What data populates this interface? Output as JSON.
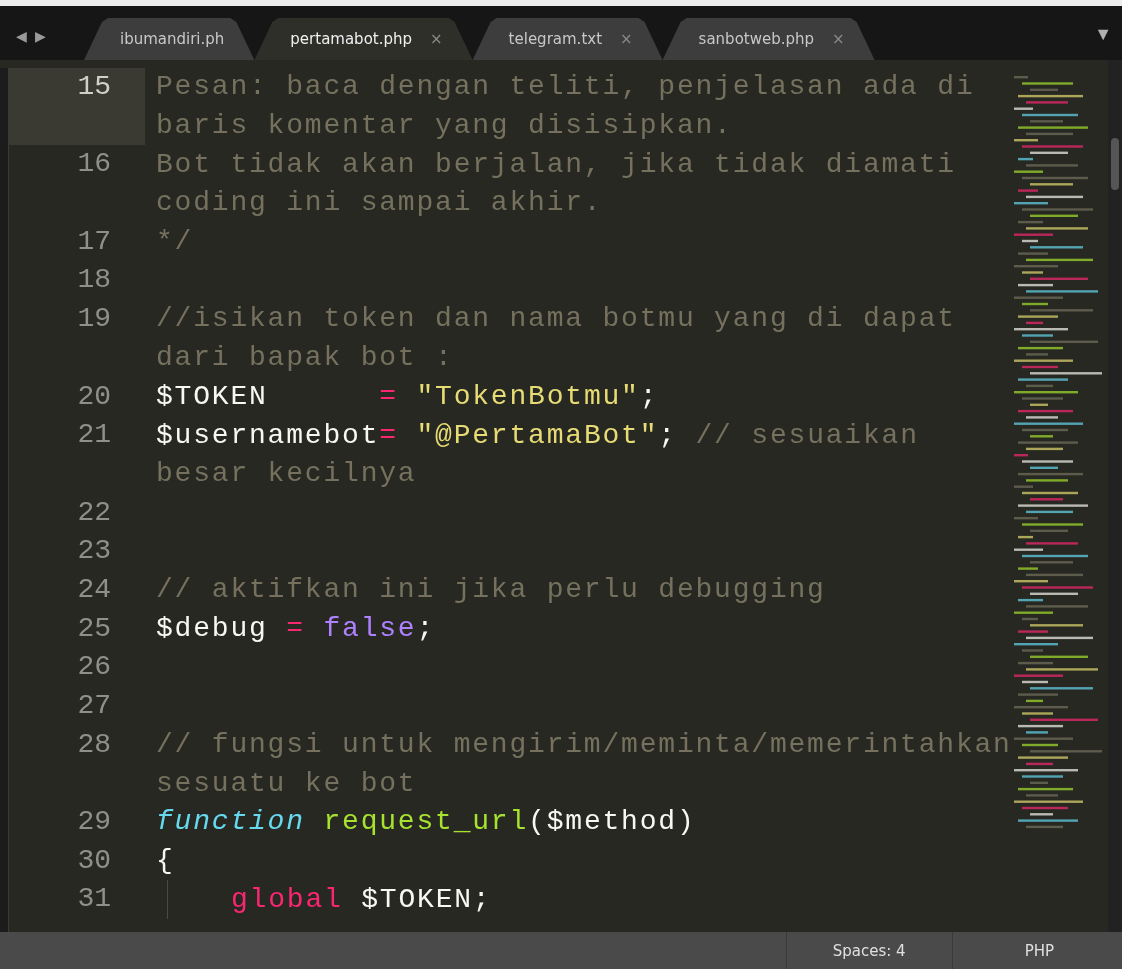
{
  "tab_bar": {
    "back": "◀",
    "forward": "▶",
    "menu": "▼",
    "tabs": [
      {
        "label": "ibumandiri.ph",
        "selected": false
      },
      {
        "label": "pertamabot.php",
        "close": "×",
        "selected": true
      },
      {
        "label": "telegram.txt",
        "close": "×",
        "selected": false
      },
      {
        "label": "sanbotweb.php",
        "close": "×",
        "selected": false
      }
    ]
  },
  "editor": {
    "lines": [
      {
        "number": "15",
        "current": true,
        "rows": [
          [
            {
              "kind": "comment",
              "text": "Pesan: baca dengan teliti, penjelasan ada di"
            }
          ],
          [
            {
              "kind": "comment",
              "text": "baris komentar yang disisipkan."
            }
          ]
        ]
      },
      {
        "number": "16",
        "current": false,
        "rows": [
          [
            {
              "kind": "comment",
              "text": "Bot tidak akan berjalan, jika tidak diamati"
            }
          ],
          [
            {
              "kind": "comment",
              "text": "coding ini sampai akhir."
            }
          ]
        ]
      },
      {
        "number": "17",
        "current": false,
        "rows": [
          [
            {
              "kind": "comment",
              "text": "*/"
            }
          ]
        ]
      },
      {
        "number": "18",
        "current": false,
        "rows": [
          []
        ]
      },
      {
        "number": "19",
        "current": false,
        "rows": [
          [
            {
              "kind": "comment",
              "text": "//isikan token dan nama botmu yang di dapat"
            }
          ],
          [
            {
              "kind": "comment",
              "text": "dari bapak bot :"
            }
          ]
        ]
      },
      {
        "number": "20",
        "current": false,
        "rows": [
          [
            {
              "kind": "plain",
              "text": "$TOKEN      "
            },
            {
              "kind": "operator",
              "text": "="
            },
            {
              "kind": "plain",
              "text": " "
            },
            {
              "kind": "string",
              "text": "\"TokenBotmu\""
            },
            {
              "kind": "plain",
              "text": ";"
            }
          ]
        ]
      },
      {
        "number": "21",
        "current": false,
        "rows": [
          [
            {
              "kind": "plain",
              "text": "$usernamebot"
            },
            {
              "kind": "operator",
              "text": "="
            },
            {
              "kind": "plain",
              "text": " "
            },
            {
              "kind": "string",
              "text": "\"@PertamaBot\""
            },
            {
              "kind": "plain",
              "text": "; "
            },
            {
              "kind": "comment",
              "text": "// sesuaikan"
            }
          ],
          [
            {
              "kind": "comment",
              "text": "besar kecilnya"
            }
          ]
        ]
      },
      {
        "number": "22",
        "current": false,
        "rows": [
          []
        ]
      },
      {
        "number": "23",
        "current": false,
        "rows": [
          []
        ]
      },
      {
        "number": "24",
        "current": false,
        "rows": [
          [
            {
              "kind": "comment",
              "text": "// aktifkan ini jika perlu debugging"
            }
          ]
        ]
      },
      {
        "number": "25",
        "current": false,
        "rows": [
          [
            {
              "kind": "plain",
              "text": "$debug "
            },
            {
              "kind": "operator",
              "text": "="
            },
            {
              "kind": "plain",
              "text": " "
            },
            {
              "kind": "constant",
              "text": "false"
            },
            {
              "kind": "plain",
              "text": ";"
            }
          ]
        ]
      },
      {
        "number": "26",
        "current": false,
        "rows": [
          []
        ]
      },
      {
        "number": "27",
        "current": false,
        "rows": [
          []
        ]
      },
      {
        "number": "28",
        "current": false,
        "rows": [
          [
            {
              "kind": "comment",
              "text": "// fungsi untuk mengirim/meminta/memerintahkan"
            }
          ],
          [
            {
              "kind": "comment",
              "text": "sesuatu ke bot"
            }
          ]
        ]
      },
      {
        "number": "29",
        "current": false,
        "rows": [
          [
            {
              "kind": "storage",
              "text": "function"
            },
            {
              "kind": "plain",
              "text": " "
            },
            {
              "kind": "entity",
              "text": "request_url"
            },
            {
              "kind": "plain",
              "text": "($method)"
            }
          ]
        ]
      },
      {
        "number": "30",
        "current": false,
        "rows": [
          [
            {
              "kind": "plain",
              "text": "{"
            }
          ]
        ]
      },
      {
        "number": "31",
        "current": false,
        "indented": true,
        "rows": [
          [
            {
              "kind": "operator",
              "text": "global"
            },
            {
              "kind": "plain",
              "text": " $TOKEN;"
            }
          ]
        ]
      }
    ]
  },
  "status_bar": {
    "indentation": "Spaces: 4",
    "syntax": "PHP"
  }
}
